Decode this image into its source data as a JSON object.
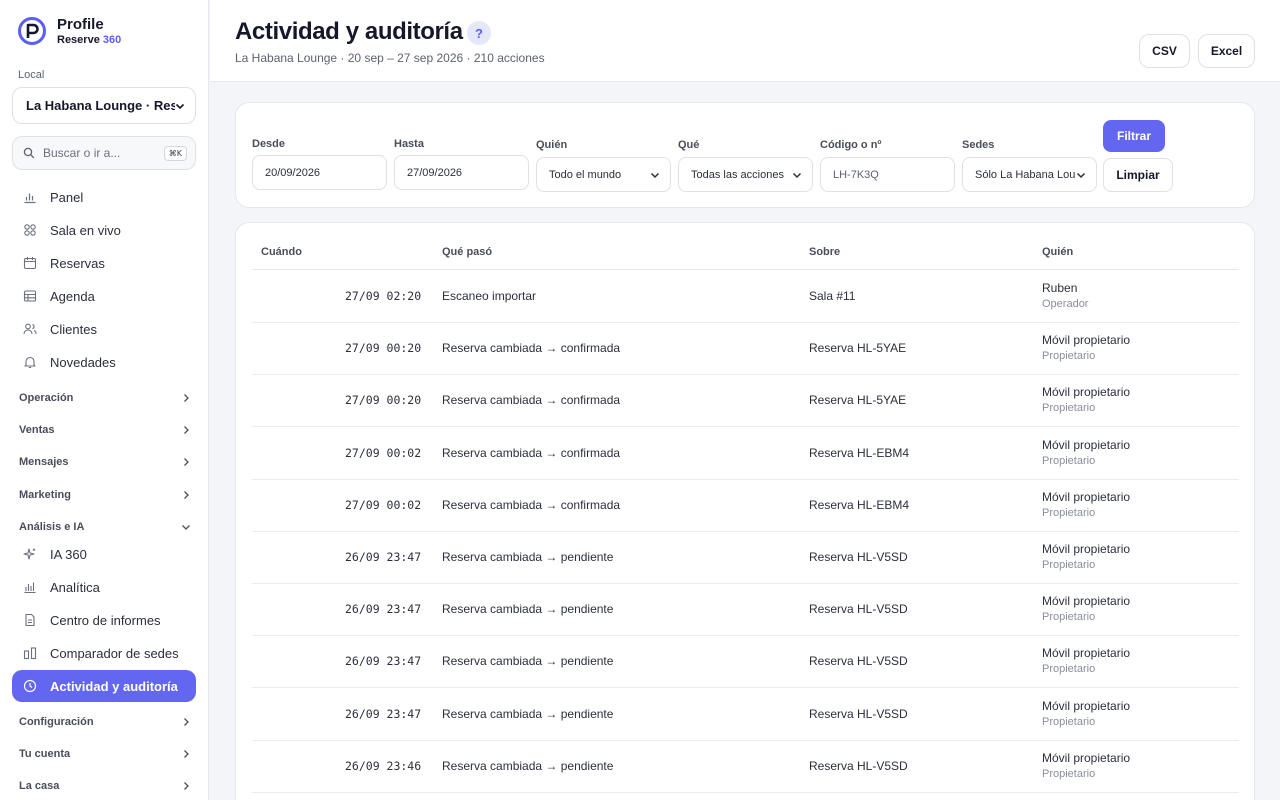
{
  "brand": {
    "name": "Profile",
    "sub_main": "Reserve",
    "sub_accent": "360",
    "accent_color": "#5b5ef4"
  },
  "sidebar": {
    "local_label": "Local",
    "local_value": "La Habana Lounge · Rest",
    "search_placeholder": "Buscar o ir a...",
    "search_shortcut": "⌘K",
    "items": [
      {
        "label": "Panel",
        "icon": "chart-bar-icon"
      },
      {
        "label": "Sala en vivo",
        "icon": "grid-icon"
      },
      {
        "label": "Reservas",
        "icon": "calendar-icon"
      },
      {
        "label": "Agenda",
        "icon": "table-icon"
      },
      {
        "label": "Clientes",
        "icon": "users-icon"
      },
      {
        "label": "Novedades",
        "icon": "bell-icon"
      }
    ],
    "sections": {
      "operacion": "Operación",
      "ventas": "Ventas",
      "mensajes": "Mensajes",
      "marketing": "Marketing",
      "analisis": "Análisis e IA",
      "configuracion": "Configuración",
      "cuenta": "Tu cuenta",
      "casa": "La casa"
    },
    "analisis_items": [
      {
        "label": "IA 360",
        "icon": "sparkle-icon"
      },
      {
        "label": "Analítica",
        "icon": "bar-chart-icon"
      },
      {
        "label": "Centro de informes",
        "icon": "document-icon"
      },
      {
        "label": "Comparador de sedes",
        "icon": "compare-icon"
      },
      {
        "label": "Actividad y auditoría",
        "icon": "clock-icon",
        "active": true
      }
    ]
  },
  "header": {
    "title": "Actividad y auditoría",
    "help": "?",
    "subtitle": "La Habana Lounge · 20 sep – 27 sep 2026 · 210 acciones",
    "csv": "CSV",
    "excel": "Excel"
  },
  "filters": {
    "desde_label": "Desde",
    "desde_value": "20/09/2026",
    "hasta_label": "Hasta",
    "hasta_value": "27/09/2026",
    "quien_label": "Quién",
    "quien_value": "Todo el mundo",
    "que_label": "Qué",
    "que_value": "Todas las acciones",
    "codigo_label": "Código o nº",
    "codigo_placeholder": "LH-7K3Q",
    "sedes_label": "Sedes",
    "sedes_value": "Sólo La Habana Lounge",
    "filtrar": "Filtrar",
    "limpiar": "Limpiar"
  },
  "table": {
    "headers": {
      "cuando": "Cuándo",
      "que": "Qué pasó",
      "sobre": "Sobre",
      "quien": "Quién"
    },
    "rows": [
      {
        "when": "27/09 02:20",
        "what": "Escaneo importar",
        "about": "Sala #11",
        "who": "Ruben",
        "role": "Operador"
      },
      {
        "when": "27/09 00:20",
        "what": "Reserva cambiada → confirmada",
        "about": "Reserva HL-5YAE",
        "who": "Móvil propietario",
        "role": "Propietario"
      },
      {
        "when": "27/09 00:20",
        "what": "Reserva cambiada → confirmada",
        "about": "Reserva HL-5YAE",
        "who": "Móvil propietario",
        "role": "Propietario"
      },
      {
        "when": "27/09 00:02",
        "what": "Reserva cambiada → confirmada",
        "about": "Reserva HL-EBM4",
        "who": "Móvil propietario",
        "role": "Propietario"
      },
      {
        "when": "27/09 00:02",
        "what": "Reserva cambiada → confirmada",
        "about": "Reserva HL-EBM4",
        "who": "Móvil propietario",
        "role": "Propietario"
      },
      {
        "when": "26/09 23:47",
        "what": "Reserva cambiada → pendiente",
        "about": "Reserva HL-V5SD",
        "who": "Móvil propietario",
        "role": "Propietario"
      },
      {
        "when": "26/09 23:47",
        "what": "Reserva cambiada → pendiente",
        "about": "Reserva HL-V5SD",
        "who": "Móvil propietario",
        "role": "Propietario"
      },
      {
        "when": "26/09 23:47",
        "what": "Reserva cambiada → pendiente",
        "about": "Reserva HL-V5SD",
        "who": "Móvil propietario",
        "role": "Propietario"
      },
      {
        "when": "26/09 23:47",
        "what": "Reserva cambiada → pendiente",
        "about": "Reserva HL-V5SD",
        "who": "Móvil propietario",
        "role": "Propietario"
      },
      {
        "when": "26/09 23:46",
        "what": "Reserva cambiada → pendiente",
        "about": "Reserva HL-V5SD",
        "who": "Móvil propietario",
        "role": "Propietario"
      }
    ]
  }
}
